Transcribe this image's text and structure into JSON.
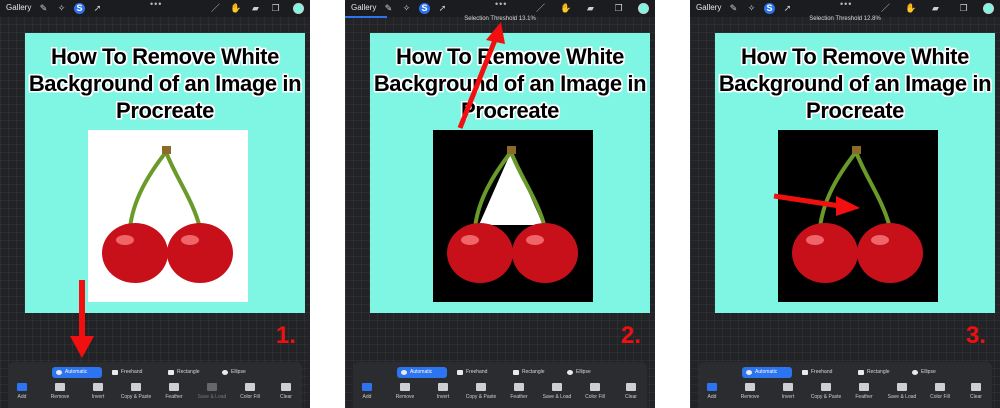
{
  "panels": [
    {
      "gallery": "Gallery",
      "threshold": "",
      "title": "How To Remove White Background of an Image in Procreate",
      "step": "1.",
      "photo_bg": "#ffffff"
    },
    {
      "gallery": "Gallery",
      "threshold": "Selection Threshold 13.1%",
      "title": "How To Remove White Background of an Image in Procreate",
      "step": "2.",
      "photo_bg": "#000000"
    },
    {
      "gallery": "Gallery",
      "threshold": "Selection Threshold 12.8%",
      "title": "How To Remove White Background of an Image in Procreate",
      "step": "3.",
      "photo_bg": "#000000"
    }
  ],
  "modes": [
    "Automatic",
    "Freehand",
    "Rectangle",
    "Ellipse"
  ],
  "tools": [
    "Add",
    "Remove",
    "Invert",
    "Copy & Paste",
    "Feather",
    "Save & Load",
    "Color Fill",
    "Clear"
  ],
  "colors": {
    "canvas": "#7ff5e3",
    "accent": "#2c74f0",
    "arrow": "#f20f0f",
    "cherry": "#c8101a",
    "stem": "#6a9a2a"
  }
}
